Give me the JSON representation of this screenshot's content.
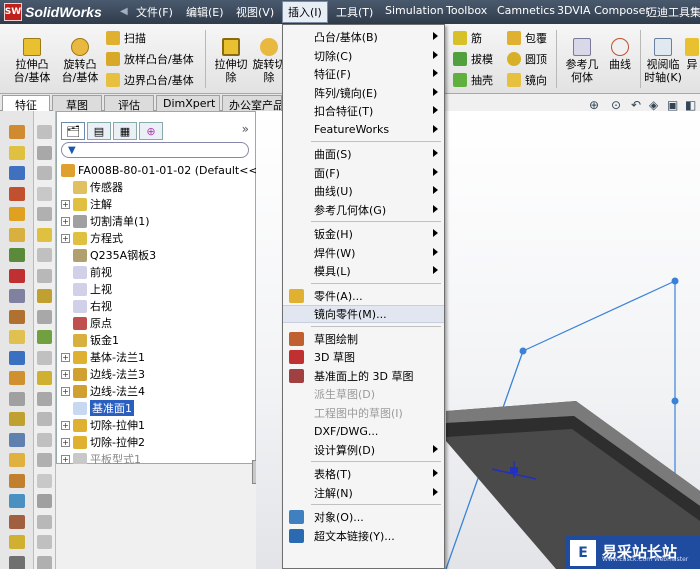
{
  "app": {
    "name": "SolidWorks",
    "logo_badge": "SW"
  },
  "menubar": {
    "items": [
      {
        "label": "文件(F)"
      },
      {
        "label": "编辑(E)"
      },
      {
        "label": "视图(V)"
      },
      {
        "label": "插入(I)"
      },
      {
        "label": "工具(T)"
      },
      {
        "label": "Simulation"
      },
      {
        "label": "Toolbox"
      },
      {
        "label": "Camnetics"
      },
      {
        "label": "3DVIA Composer"
      },
      {
        "label": "迈迪工具集"
      }
    ],
    "active_index": 3
  },
  "toolbar": {
    "extrude_boss": "拉伸凸\n台/基体",
    "revolve_boss": "旋转凸\n台/基体",
    "sweep": "扫描",
    "loft": "放样凸台/基体",
    "boundary": "边界凸台/基体",
    "extrude_cut": "拉伸切\n除",
    "revolve_cut": "旋转切\n除",
    "rib": "筋",
    "draft": "拔模",
    "shell": "抽壳",
    "wrap": "包覆",
    "dome": "圆顶",
    "mirror": "镜向",
    "ref_geometry": "参考几\n何体",
    "curves": "曲线",
    "instant3d": "视阅临\n时轴(K)",
    "more": "异"
  },
  "tabs": [
    "特征",
    "草图",
    "评估",
    "DimXpert",
    "办公室产品"
  ],
  "tree": {
    "root": "FA008B-80-01-01-02  (Default<<",
    "nodes": [
      {
        "label": "传感器",
        "exp": false
      },
      {
        "label": "注解",
        "exp": true
      },
      {
        "label": "切割清单(1)",
        "exp": true
      },
      {
        "label": "方程式",
        "exp": true
      },
      {
        "label": "Q235A钢板3",
        "exp": false
      },
      {
        "label": "前视",
        "exp": false
      },
      {
        "label": "上视",
        "exp": false
      },
      {
        "label": "右视",
        "exp": false
      },
      {
        "label": "原点",
        "exp": false
      },
      {
        "label": "钣金1",
        "exp": false
      },
      {
        "label": "基体-法兰1",
        "exp": true
      },
      {
        "label": "边线-法兰3",
        "exp": true
      },
      {
        "label": "边线-法兰4",
        "exp": true
      },
      {
        "label": "基准面1",
        "exp": false
      },
      {
        "label": "切除-拉伸1",
        "exp": true
      },
      {
        "label": "切除-拉伸2",
        "exp": true
      },
      {
        "label": "平板型式1",
        "exp": true
      }
    ]
  },
  "dropdown": {
    "items": [
      {
        "label": "凸台/基体(B)",
        "sub": true
      },
      {
        "label": "切除(C)",
        "sub": true
      },
      {
        "label": "特征(F)",
        "sub": true
      },
      {
        "label": "阵列/镜向(E)",
        "sub": true
      },
      {
        "label": "扣合特征(T)",
        "sub": true
      },
      {
        "label": "FeatureWorks",
        "sub": true
      },
      {
        "label": "曲面(S)",
        "sub": true
      },
      {
        "label": "面(F)",
        "sub": true
      },
      {
        "label": "曲线(U)",
        "sub": true
      },
      {
        "label": "参考几何体(G)",
        "sub": true
      },
      {
        "label": "钣金(H)",
        "sub": true
      },
      {
        "label": "焊件(W)",
        "sub": true
      },
      {
        "label": "模具(L)",
        "sub": true
      },
      {
        "label": "零件(A)...",
        "sub": false
      },
      {
        "label": "镜向零件(M)...",
        "sub": false
      },
      {
        "label": "草图绘制",
        "sub": false
      },
      {
        "label": "3D 草图",
        "sub": false
      },
      {
        "label": "基准面上的 3D 草图",
        "sub": false
      },
      {
        "label": "派生草图(D)",
        "sub": false
      },
      {
        "label": "工程图中的草图(I)",
        "sub": false
      },
      {
        "label": "DXF/DWG...",
        "sub": false
      },
      {
        "label": "设计算例(D)",
        "sub": true
      },
      {
        "label": "表格(T)",
        "sub": true
      },
      {
        "label": "注解(N)",
        "sub": true
      },
      {
        "label": "对象(O)...",
        "sub": false
      },
      {
        "label": "超文本链接(Y)...",
        "sub": false
      }
    ],
    "highlighted": "镜向零件(M)...",
    "disabled": [
      "派生草图(D)",
      "工程图中的草图(I)"
    ]
  },
  "watermark": {
    "title": "易采站长站",
    "sub": "Www.Easck.Com Webmaster",
    "badge": "E"
  },
  "colors": {
    "menubar": "#2f3b4a",
    "selection": "#2a5fc0",
    "sketch_line": "#3a82d8",
    "watermark": "#1f4c9e"
  }
}
